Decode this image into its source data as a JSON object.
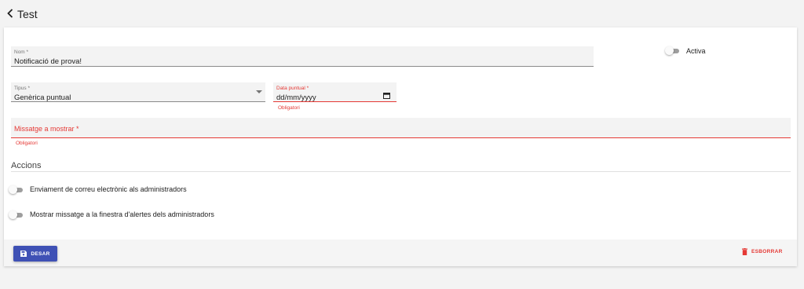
{
  "header": {
    "title": "Test"
  },
  "form": {
    "nom": {
      "label": "Nom *",
      "value": "Notificació de prova!"
    },
    "activa": {
      "label": "Activa",
      "checked": false
    },
    "tipus": {
      "label": "Tipus *",
      "value": "Genèrica puntual"
    },
    "data_puntual": {
      "label": "Data puntual *",
      "value": "dd/mm/yyyy",
      "error": "Obligatori"
    },
    "missatge": {
      "label": "Missatge a mostrar *",
      "error": "Obligatori"
    }
  },
  "accions": {
    "title": "Accions",
    "items": [
      {
        "label": "Enviament de correu electrònic als administradors",
        "checked": false
      },
      {
        "label": "Mostrar missatge a la finestra d'alertes dels administradors",
        "checked": false
      }
    ]
  },
  "footer": {
    "save_label": "DESAR",
    "delete_label": "ESBORRAR"
  },
  "colors": {
    "primary": "#3f51b5",
    "error": "#e53935"
  }
}
